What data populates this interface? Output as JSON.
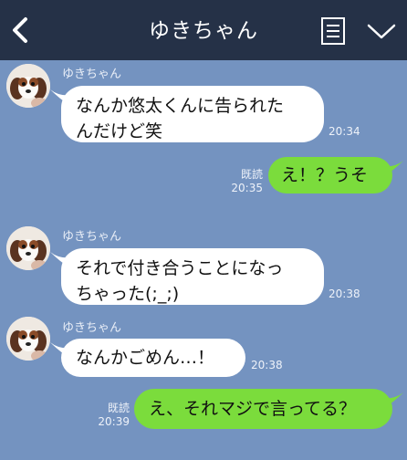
{
  "header": {
    "title": "ゆきちゃん",
    "back_icon": "chevron-left-icon",
    "memo_icon": "note-icon",
    "menu_icon": "chevron-down-icon",
    "bg_color": "#253147"
  },
  "chat": {
    "bg_color": "#7493c0",
    "incoming_bubble_color": "#ffffff",
    "outgoing_bubble_color": "#7bdc3c",
    "messages": [
      {
        "direction": "in",
        "sender": "ゆきちゃん",
        "text": "なんか悠太くんに告られた\nんだけど笑",
        "time": "20:34"
      },
      {
        "direction": "out",
        "text": "え！？うそ",
        "read": "既読",
        "time": "20:35"
      },
      {
        "direction": "in",
        "sender": "ゆきちゃん",
        "text": "それで付き合うことになっ\nちゃった(;_;)",
        "time": "20:38"
      },
      {
        "direction": "in",
        "sender": "ゆきちゃん",
        "text": "なんかごめん…！",
        "time": "20:38"
      },
      {
        "direction": "out",
        "text": "え、それマジで言ってる？",
        "read": "既読",
        "time": "20:39"
      }
    ]
  }
}
